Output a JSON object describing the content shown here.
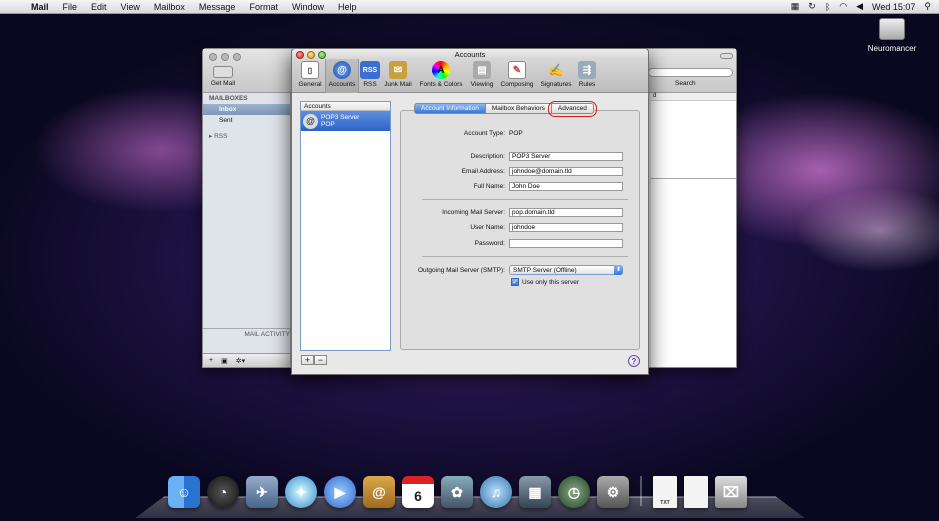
{
  "menubar": {
    "apple": "",
    "items": [
      "Mail",
      "File",
      "Edit",
      "View",
      "Mailbox",
      "Message",
      "Format",
      "Window",
      "Help"
    ],
    "clock": "Wed 15:07"
  },
  "desktop": {
    "drive_label": "Neuromancer"
  },
  "mail_window": {
    "get_mail": "Get Mail",
    "search_label": "Search",
    "mailboxes_header": "MAILBOXES",
    "inbox": "Inbox",
    "sent": "Sent",
    "rss": "RSS",
    "activity": "MAIL ACTIVITY",
    "column_partial": "d"
  },
  "prefs": {
    "title": "Accounts",
    "toolbar": [
      "General",
      "Accounts",
      "RSS",
      "Junk Mail",
      "Fonts & Colors",
      "Viewing",
      "Composing",
      "Signatures",
      "Rules"
    ],
    "accounts_header": "Accounts",
    "account": {
      "name": "POP3 Server",
      "type": "POP"
    },
    "tabs": [
      "Account Information",
      "Mailbox Behaviors",
      "Advanced"
    ],
    "fields": {
      "account_type_label": "Account Type:",
      "account_type_value": "POP",
      "description_label": "Description:",
      "description_value": "POP3 Server",
      "email_label": "Email Address:",
      "email_value": "johndoe@domain.tld",
      "fullname_label": "Full Name:",
      "fullname_value": "John Doe",
      "incoming_label": "Incoming Mail Server:",
      "incoming_value": "pop.domain.tld",
      "username_label": "User Name:",
      "username_value": "johndoe",
      "password_label": "Password:",
      "password_value": "",
      "outgoing_label": "Outgoing Mail Server (SMTP):",
      "outgoing_value": "SMTP Server (Offline)",
      "use_only_label": "Use only this server"
    },
    "help": "?"
  },
  "dock": {
    "cal_day": "6",
    "doc_label": "TXT"
  }
}
